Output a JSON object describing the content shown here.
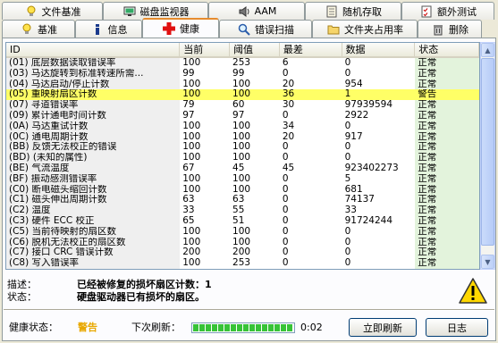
{
  "tabs_row1": [
    {
      "label": "文件基准",
      "icon": "lightbulb-icon"
    },
    {
      "label": "磁盘监视器",
      "icon": "monitor-icon"
    },
    {
      "label": "AAM",
      "icon": "speaker-icon"
    },
    {
      "label": "随机存取",
      "icon": "notepad-icon"
    },
    {
      "label": "额外测试",
      "icon": "checklist-icon"
    }
  ],
  "tabs_row2": [
    {
      "label": "基准",
      "icon": "lightbulb-icon"
    },
    {
      "label": "信息",
      "icon": "info-icon"
    },
    {
      "label": "健康",
      "icon": "red-cross-icon"
    },
    {
      "label": "错误扫描",
      "icon": "magnifier-icon"
    },
    {
      "label": "文件夹占用率",
      "icon": "folder-icon"
    },
    {
      "label": "删除",
      "icon": "trash-icon"
    }
  ],
  "table": {
    "headers": [
      "ID",
      "当前",
      "阈值",
      "最差",
      "数据",
      "状态"
    ],
    "rows": [
      {
        "id": "(01) 底层数据读取错误率",
        "cur": "100",
        "thr": "253",
        "wor": "6",
        "dat": "0",
        "sta": "正常"
      },
      {
        "id": "(03) 马达旋转到标准转速所需...",
        "cur": "99",
        "thr": "99",
        "wor": "0",
        "dat": "0",
        "sta": "正常"
      },
      {
        "id": "(04) 马达启动/停止计数",
        "cur": "100",
        "thr": "100",
        "wor": "20",
        "dat": "954",
        "sta": "正常"
      },
      {
        "id": "(05) 重映射扇区计数",
        "cur": "100",
        "thr": "100",
        "wor": "36",
        "dat": "1",
        "sta": "警告",
        "warn": true
      },
      {
        "id": "(07) 寻道错误率",
        "cur": "79",
        "thr": "60",
        "wor": "30",
        "dat": "97939594",
        "sta": "正常"
      },
      {
        "id": "(09) 累计通电时间计数",
        "cur": "97",
        "thr": "97",
        "wor": "0",
        "dat": "2922",
        "sta": "正常"
      },
      {
        "id": "(0A) 马达重试计数",
        "cur": "100",
        "thr": "100",
        "wor": "34",
        "dat": "0",
        "sta": "正常"
      },
      {
        "id": "(0C) 通电周期计数",
        "cur": "100",
        "thr": "100",
        "wor": "20",
        "dat": "917",
        "sta": "正常"
      },
      {
        "id": "(BB) 反馈无法校正的错误",
        "cur": "100",
        "thr": "100",
        "wor": "0",
        "dat": "0",
        "sta": "正常"
      },
      {
        "id": "(BD) (未知的属性)",
        "cur": "100",
        "thr": "100",
        "wor": "0",
        "dat": "0",
        "sta": "正常"
      },
      {
        "id": "(BE) 气流温度",
        "cur": "67",
        "thr": "45",
        "wor": "45",
        "dat": "923402273",
        "sta": "正常"
      },
      {
        "id": "(BF) 振动感测错误率",
        "cur": "100",
        "thr": "100",
        "wor": "0",
        "dat": "5",
        "sta": "正常"
      },
      {
        "id": "(C0) 断电磁头缩回计数",
        "cur": "100",
        "thr": "100",
        "wor": "0",
        "dat": "681",
        "sta": "正常"
      },
      {
        "id": "(C1) 磁头伸出周期计数",
        "cur": "63",
        "thr": "63",
        "wor": "0",
        "dat": "74137",
        "sta": "正常"
      },
      {
        "id": "(C2) 温度",
        "cur": "33",
        "thr": "55",
        "wor": "0",
        "dat": "33",
        "sta": "正常"
      },
      {
        "id": "(C3) 硬件 ECC 校正",
        "cur": "65",
        "thr": "51",
        "wor": "0",
        "dat": "91724244",
        "sta": "正常"
      },
      {
        "id": "(C5) 当前待映射的扇区数",
        "cur": "100",
        "thr": "100",
        "wor": "0",
        "dat": "0",
        "sta": "正常"
      },
      {
        "id": "(C6) 脱机无法校正的扇区数",
        "cur": "100",
        "thr": "100",
        "wor": "0",
        "dat": "0",
        "sta": "正常"
      },
      {
        "id": "(C7) 接口 CRC 错误计数",
        "cur": "200",
        "thr": "200",
        "wor": "0",
        "dat": "0",
        "sta": "正常"
      },
      {
        "id": "(C8) 写入错误率",
        "cur": "100",
        "thr": "253",
        "wor": "0",
        "dat": "0",
        "sta": "正常"
      }
    ]
  },
  "details": {
    "desc_label": "描述：",
    "desc_value": "已经被修复的损坏扇区计数：1",
    "status_label": "状态：",
    "status_value": "硬盘驱动器已有损坏的扇区。"
  },
  "footer": {
    "health_label": "健康状态：",
    "health_value": "警告",
    "next_refresh_label": "下次刷新：",
    "progress": 1.0,
    "time": "0:02",
    "refresh_button": "立即刷新",
    "log_button": "日志"
  },
  "colors": {
    "warn_row": "#ffff66",
    "status_col": "#e3f3dc",
    "health_warn": "#e8a800",
    "progress": "#37c337"
  }
}
